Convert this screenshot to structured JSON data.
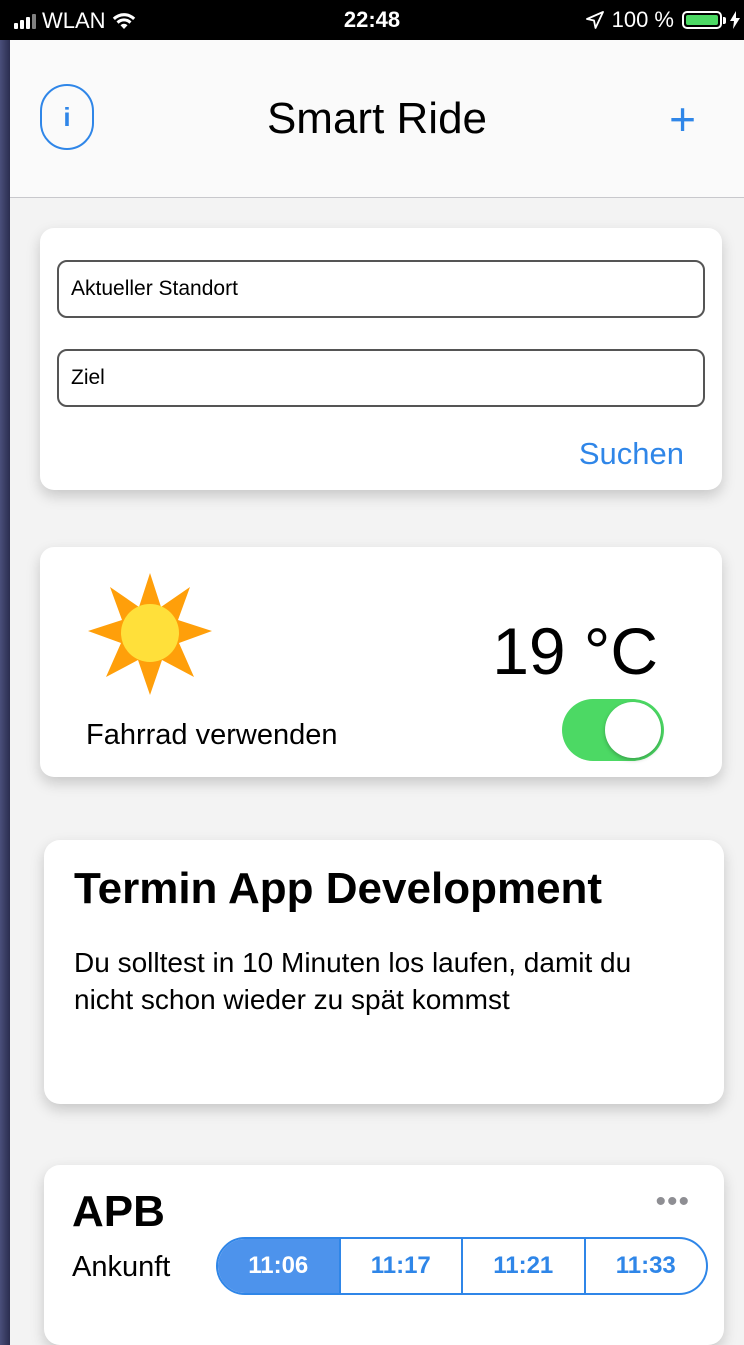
{
  "status_bar": {
    "carrier": "WLAN",
    "time": "22:48",
    "battery": "100 %",
    "battery_level": 1.0
  },
  "nav": {
    "title": "Smart Ride",
    "info_label": "i",
    "add_label": "+"
  },
  "search": {
    "from_placeholder": "Aktueller Standort",
    "to_placeholder": "Ziel",
    "search_label": "Suchen"
  },
  "weather": {
    "icon": "sun-icon",
    "temperature": "19 °C",
    "bike_label": "Fahrrad verwenden",
    "bike_toggle_on": true
  },
  "appointment": {
    "title": "Termin App Development",
    "text": "Du solltest in 10 Minuten los laufen, damit du nicht schon wieder zu spät kommst"
  },
  "transit": {
    "name": "APB",
    "more_label": "•••",
    "arrival_label": "Ankunft",
    "times": [
      "11:06",
      "11:17",
      "11:21",
      "11:33"
    ],
    "selected_index": 0
  },
  "colors": {
    "accent": "#2f86e8",
    "toggle_on": "#4cd964",
    "sun_outer": "#ff9f0a",
    "sun_inner": "#ffe03a"
  }
}
